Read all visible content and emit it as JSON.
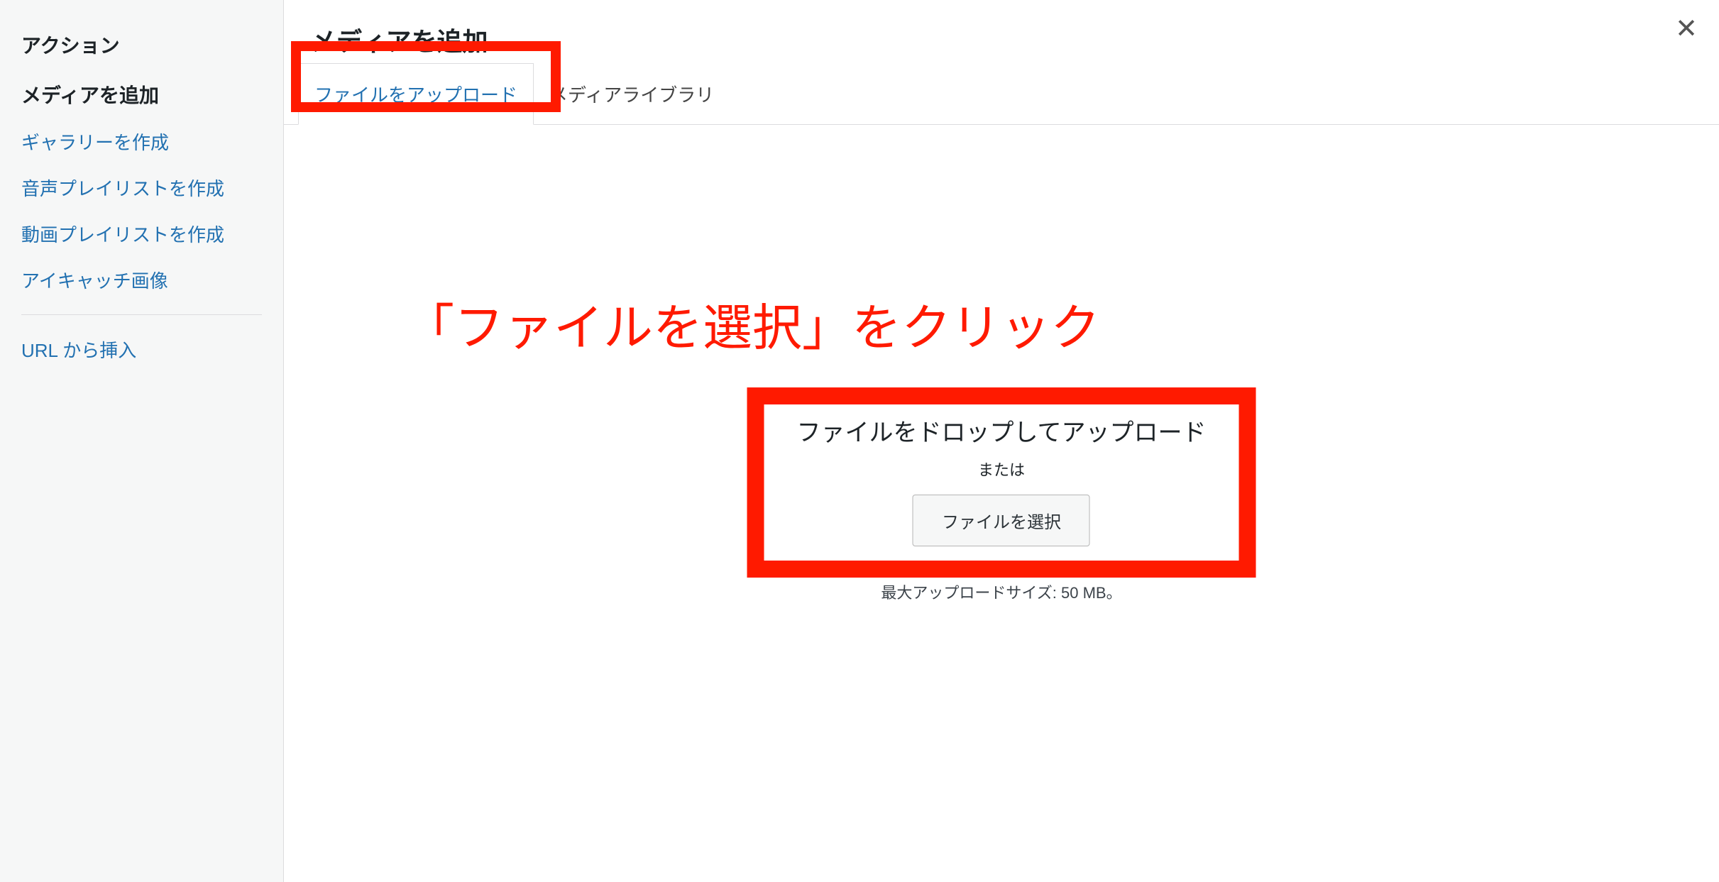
{
  "sidebar": {
    "actions_heading": "アクション",
    "add_media_heading": "メディアを追加",
    "items": [
      "ギャラリーを作成",
      "音声プレイリストを作成",
      "動画プレイリストを作成",
      "アイキャッチ画像"
    ],
    "insert_from_url": "URL から挿入"
  },
  "main": {
    "title": "メディアを追加",
    "tabs": {
      "upload": "ファイルをアップロード",
      "library": "メディアライブラリ"
    },
    "dropzone": {
      "title": "ファイルをドロップしてアップロード",
      "or": "または",
      "select_button": "ファイルを選択",
      "max_size": "最大アップロードサイズ: 50 MB。"
    }
  },
  "annotation": "「ファイルを選択」をクリック"
}
